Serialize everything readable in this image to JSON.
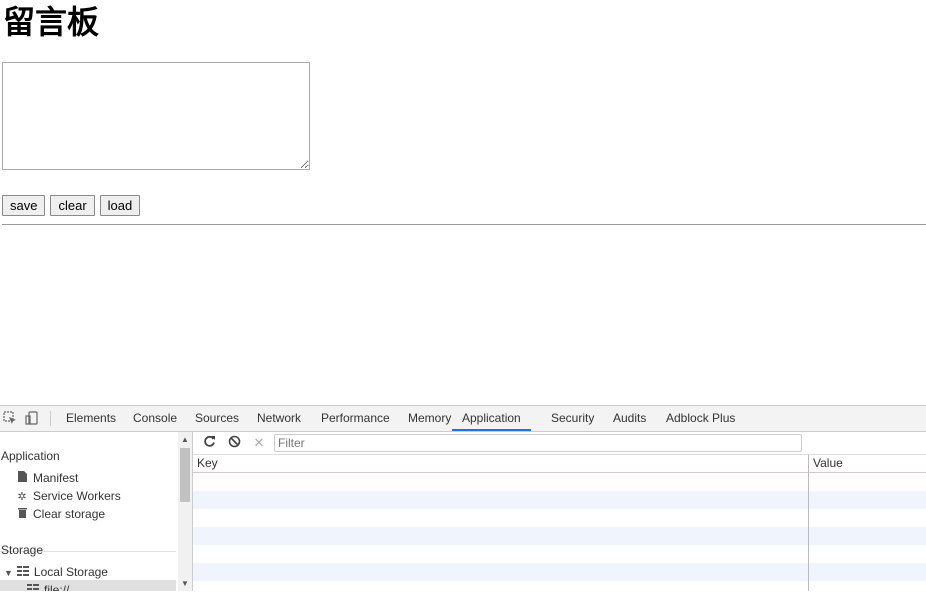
{
  "page": {
    "title": "留言板",
    "buttons": {
      "save": "save",
      "clear": "clear",
      "load": "load"
    }
  },
  "devtools": {
    "tabs": [
      "Elements",
      "Console",
      "Sources",
      "Network",
      "Performance",
      "Memory",
      "Application",
      "Security",
      "Audits",
      "Adblock Plus"
    ],
    "active_tab": "Application",
    "accent_color": "#1a73e8",
    "sidebar": {
      "application_heading": "Application",
      "application_items": [
        {
          "label": "Manifest",
          "icon": "file-icon"
        },
        {
          "label": "Service Workers",
          "icon": "gear-icon"
        },
        {
          "label": "Clear storage",
          "icon": "trash-icon"
        }
      ],
      "storage_heading": "Storage",
      "local_storage": {
        "label": "Local Storage",
        "icon": "grid-icon",
        "expanded": true
      },
      "local_storage_child": {
        "label": "file://",
        "icon": "grid-icon",
        "selected": true
      }
    },
    "toolbar": {
      "refresh_icon": "refresh-icon",
      "clear_all_icon": "block-icon",
      "delete_icon": "close-icon",
      "filter_placeholder": "Filter"
    },
    "table": {
      "columns": [
        "Key",
        "Value"
      ],
      "row_colors": [
        "#ffffff",
        "#f0f4fc"
      ]
    }
  }
}
